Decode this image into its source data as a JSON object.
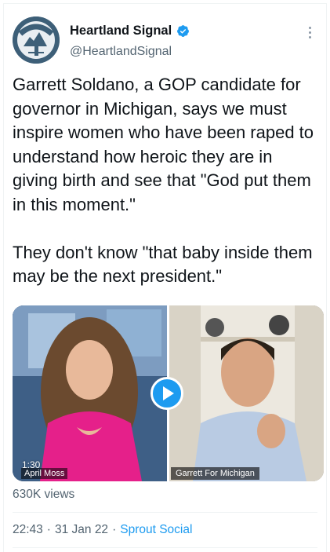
{
  "author": {
    "display_name": "Heartland Signal",
    "handle": "@HeartlandSignal",
    "avatar_text": "HEARTLAND SIGNAL",
    "verified": true
  },
  "tweet": {
    "text": "Garrett Soldano, a GOP candidate for governor in Michigan, says we must inspire women who have been raped to understand how heroic they are in giving birth and see that \"God put them in this moment.\"\n\nThey don't know \"that baby inside them may be the next president.\""
  },
  "media": {
    "type": "video",
    "duration": "1:30",
    "left_caption": "April Moss",
    "right_caption": "Garrett For Michigan"
  },
  "stats": {
    "views": "630K views"
  },
  "meta": {
    "time": "22:43",
    "date": "31 Jan 22",
    "separator": "·",
    "source": "Sprout Social"
  },
  "colors": {
    "accent": "#1d9bf0",
    "text_primary": "#0f1419",
    "text_secondary": "#536471"
  },
  "icons": {
    "verified": "verified-badge-icon",
    "more": "more-options-icon",
    "play": "play-icon"
  }
}
